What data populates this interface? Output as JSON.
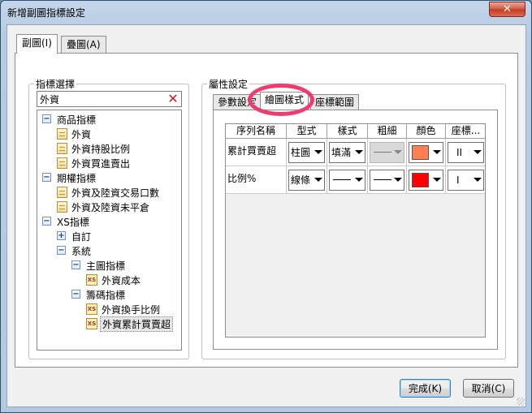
{
  "window": {
    "title": "新增副圖指標設定",
    "close_glyph": "✕"
  },
  "main_tabs": [
    {
      "label": "副圖(I)",
      "active": true
    },
    {
      "label": "疊圖(A)",
      "active": false
    }
  ],
  "indicator_panel": {
    "legend": "指標選擇",
    "search": {
      "value": "外資",
      "clear_glyph": "✕"
    },
    "tree": [
      {
        "label": "商品指標",
        "type": "folder",
        "expanded": true,
        "glyph": "−"
      },
      {
        "label": "外資",
        "type": "doc"
      },
      {
        "label": "外資持股比例",
        "type": "doc"
      },
      {
        "label": "外資買進賣出",
        "type": "doc"
      },
      {
        "label": "期權指標",
        "type": "folder",
        "expanded": true,
        "glyph": "−"
      },
      {
        "label": "外資及陸資交易口數",
        "type": "doc"
      },
      {
        "label": "外資及陸資未平倉",
        "type": "doc"
      },
      {
        "label": "XS指標",
        "type": "folder",
        "expanded": true,
        "glyph": "−"
      },
      {
        "label": "自訂",
        "type": "folder",
        "expanded": false,
        "glyph": "+"
      },
      {
        "label": "系統",
        "type": "folder",
        "expanded": true,
        "glyph": "−"
      },
      {
        "label": "主圖指標",
        "type": "folder",
        "expanded": true,
        "glyph": "−"
      },
      {
        "label": "外資成本",
        "type": "xs",
        "icon_text": "XS"
      },
      {
        "label": "籌碼指標",
        "type": "folder",
        "expanded": true,
        "glyph": "−"
      },
      {
        "label": "外資換手比例",
        "type": "xs",
        "icon_text": "XS"
      },
      {
        "label": "外資累計買賣超",
        "type": "xs",
        "icon_text": "XS",
        "selected": true
      }
    ]
  },
  "property_panel": {
    "legend": "屬性設定",
    "tabs": [
      {
        "label": "參數設定",
        "active": false
      },
      {
        "label": "繪圖樣式",
        "active": true
      },
      {
        "label": "座標範圍",
        "active": false
      }
    ],
    "columns": [
      "序列名稱",
      "型式",
      "樣式",
      "粗細",
      "顏色",
      "座標..."
    ],
    "rows": [
      {
        "name": "累計買賣超",
        "type": "柱圖",
        "style": "填滿",
        "thickness": "",
        "color": "#ff8050",
        "axis": "II",
        "style_line": false,
        "thickness_disabled": true
      },
      {
        "name": "比例%",
        "type": "線條",
        "style": "",
        "thickness": "",
        "color": "#ff0000",
        "axis": "I",
        "style_line": true,
        "thickness_disabled": false
      }
    ]
  },
  "buttons": {
    "ok": "完成(K)",
    "cancel": "取消(C)"
  },
  "colors": {
    "highlight_circle": "#ef3b6e"
  }
}
